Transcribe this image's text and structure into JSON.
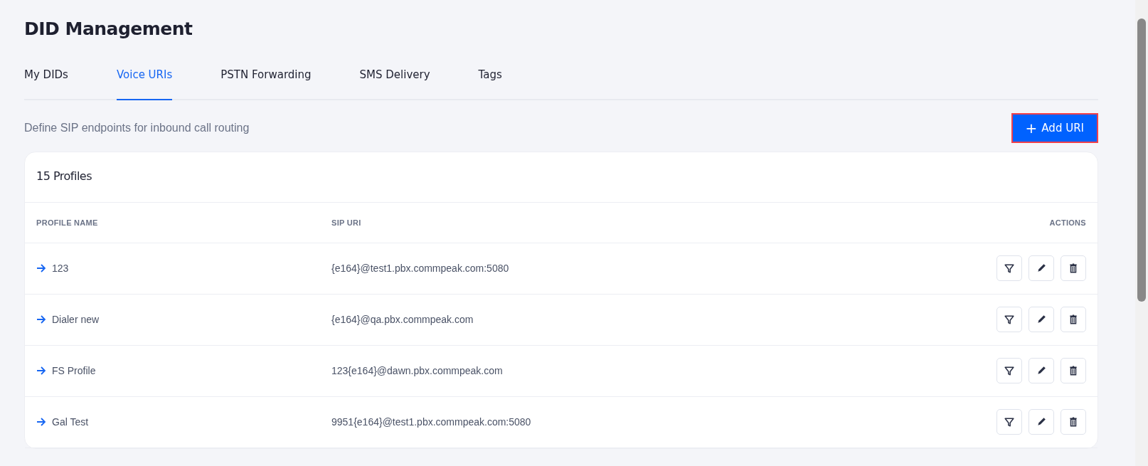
{
  "page": {
    "title": "DID Management",
    "subtitle": "Define SIP endpoints for inbound call routing"
  },
  "tabs": [
    {
      "label": "My DIDs",
      "selected": false
    },
    {
      "label": "Voice URIs",
      "selected": true
    },
    {
      "label": "PSTN Forwarding",
      "selected": false
    },
    {
      "label": "SMS Delivery",
      "selected": false
    },
    {
      "label": "Tags",
      "selected": false
    }
  ],
  "add_button": {
    "icon": "+",
    "label": "Add URI"
  },
  "table": {
    "count": "15 Profiles",
    "columns": [
      "PROFILE NAME",
      "SIP URI",
      "ACTIONS"
    ],
    "rows": [
      {
        "name": "123",
        "sip_uri": "{e164}@test1.pbx.commpeak.com:5080"
      },
      {
        "name": "Dialer new",
        "sip_uri": "{e164}@qa.pbx.commpeak.com"
      },
      {
        "name": "FS Profile",
        "sip_uri": "123{e164}@dawn.pbx.commpeak.com"
      },
      {
        "name": "Gal Test",
        "sip_uri": "9951{e164}@test1.pbx.commpeak.com:5080"
      }
    ]
  }
}
